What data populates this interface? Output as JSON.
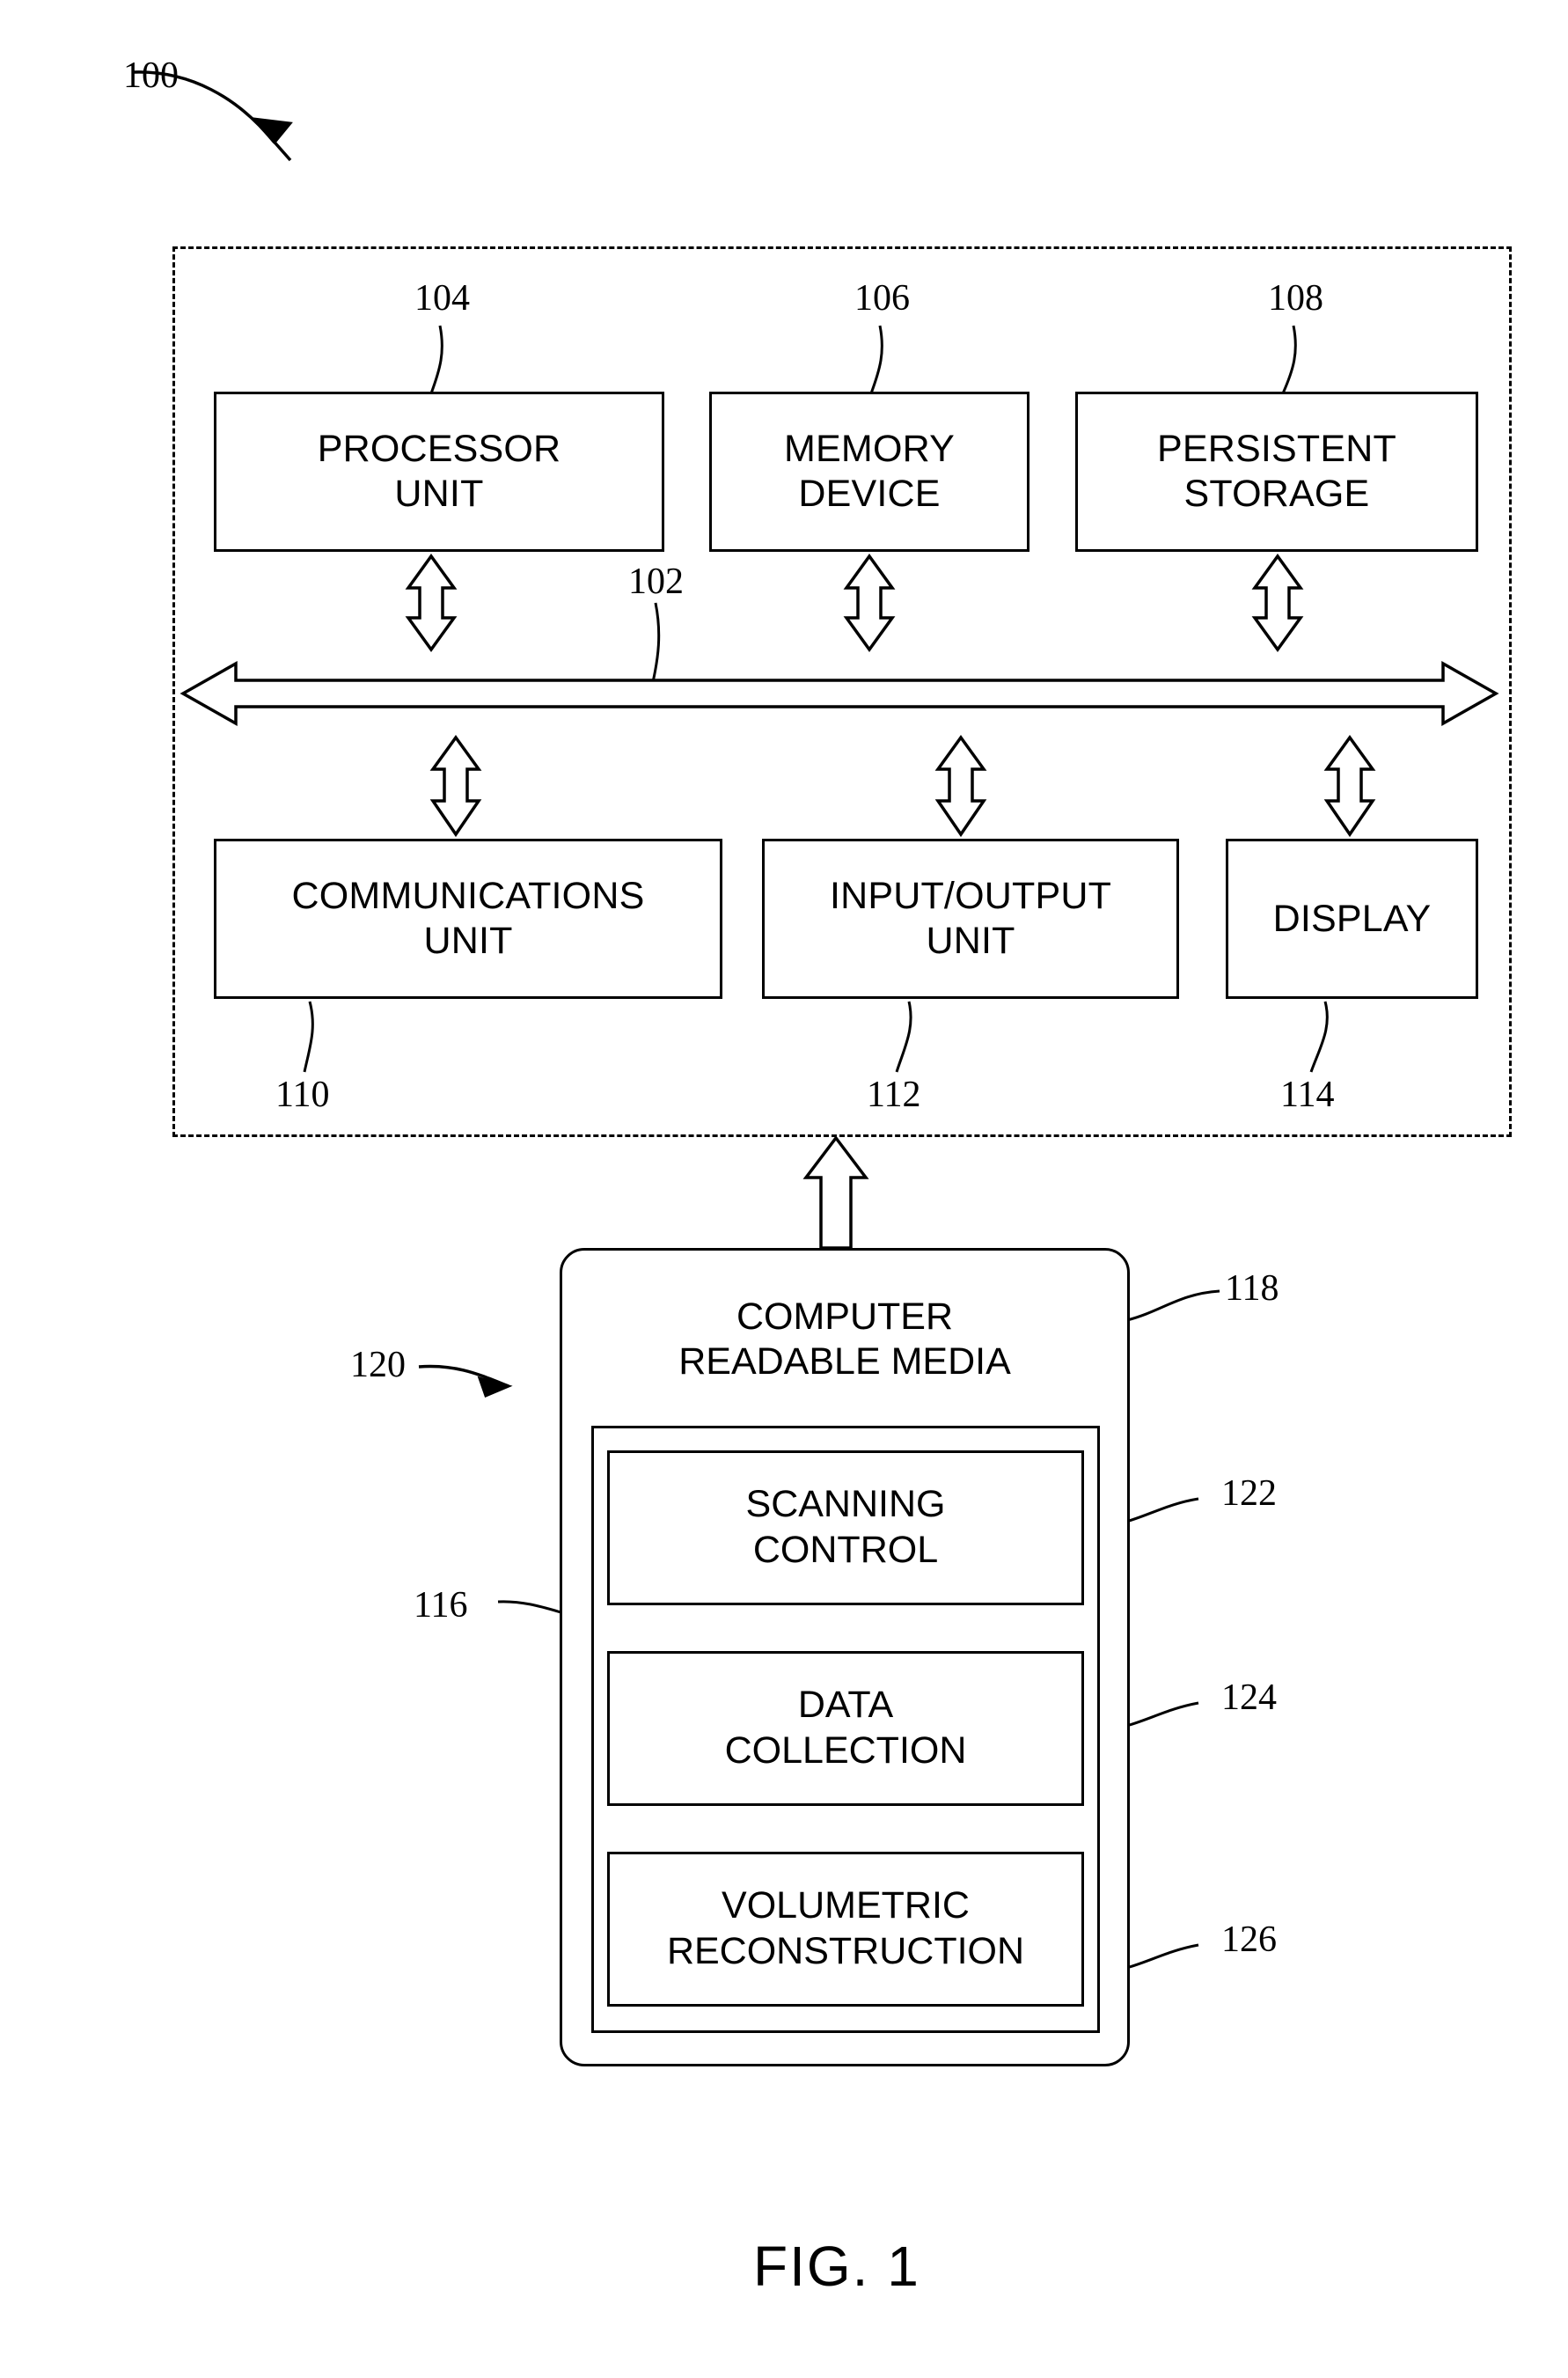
{
  "figure": {
    "caption": "FIG. 1",
    "system_ref": "100"
  },
  "data_processing_system": {
    "ref": "100",
    "bus": {
      "ref": "102",
      "name": "bus-double-arrow"
    },
    "top_row": [
      {
        "ref": "104",
        "label": "PROCESSOR\nUNIT",
        "name": "processor-unit"
      },
      {
        "ref": "106",
        "label": "MEMORY\nDEVICE",
        "name": "memory-device"
      },
      {
        "ref": "108",
        "label": "PERSISTENT\nSTORAGE",
        "name": "persistent-storage"
      }
    ],
    "bottom_row": [
      {
        "ref": "110",
        "label": "COMMUNICATIONS\nUNIT",
        "name": "communications-unit"
      },
      {
        "ref": "112",
        "label": "INPUT/OUTPUT\nUNIT",
        "name": "input-output-unit"
      },
      {
        "ref": "114",
        "label": "DISPLAY",
        "name": "display"
      }
    ]
  },
  "computer_program_product": {
    "ref": "120",
    "media": {
      "ref": "118",
      "label": "COMPUTER\nREADABLE MEDIA"
    },
    "program_code": {
      "ref": "116"
    },
    "modules": [
      {
        "ref": "122",
        "label": "SCANNING\nCONTROL",
        "name": "scanning-control"
      },
      {
        "ref": "124",
        "label": "DATA\nCOLLECTION",
        "name": "data-collection"
      },
      {
        "ref": "126",
        "label": "VOLUMETRIC\nRECONSTRUCTION",
        "name": "volumetric-reconstruction"
      }
    ]
  },
  "colors": {
    "ink": "#000000",
    "paper": "#ffffff"
  }
}
